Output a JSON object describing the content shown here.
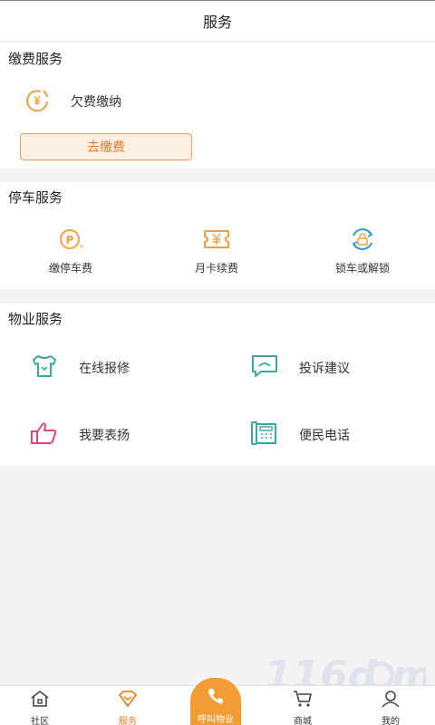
{
  "header": {
    "title": "服务"
  },
  "payment": {
    "title": "缴费服务",
    "item_label": "欠费缴纳",
    "button_label": "去缴费"
  },
  "parking": {
    "title": "停车服务",
    "items": [
      {
        "label": "缴停车费",
        "icon": "parking-fee-icon"
      },
      {
        "label": "月卡续费",
        "icon": "monthly-card-icon"
      },
      {
        "label": "锁车或解锁",
        "icon": "car-lock-icon"
      }
    ]
  },
  "property": {
    "title": "物业服务",
    "items": [
      {
        "label": "在线报修",
        "icon": "repair-icon"
      },
      {
        "label": "投诉建议",
        "icon": "complaint-icon"
      },
      {
        "label": "我要表扬",
        "icon": "thumbs-up-icon"
      },
      {
        "label": "便民电话",
        "icon": "phone-directory-icon"
      }
    ]
  },
  "bottom_nav": {
    "items": [
      {
        "label": "社区",
        "icon": "home-icon"
      },
      {
        "label": "服务",
        "icon": "service-icon",
        "active": true
      },
      {
        "label": "呼叫物业",
        "icon": "phone-icon"
      },
      {
        "label": "商城",
        "icon": "cart-icon"
      },
      {
        "label": "我的",
        "icon": "user-icon"
      }
    ]
  },
  "colors": {
    "accent": "#f39c34",
    "active_nav": "#e67e22",
    "teal": "#3aa9a0",
    "pink": "#e0477b"
  }
}
